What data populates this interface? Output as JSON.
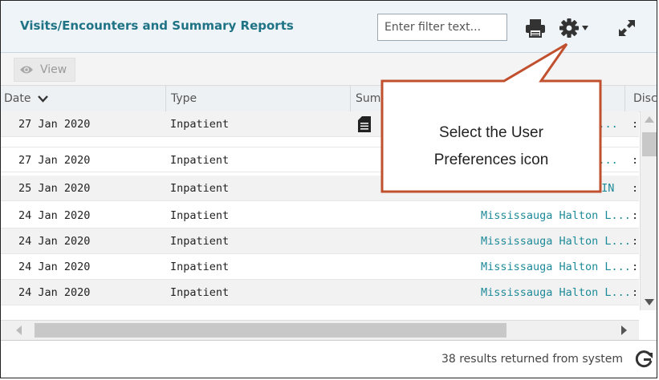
{
  "panel": {
    "title": "Visits/Encounters and Summary Reports",
    "filter_placeholder": "Enter filter text...",
    "print_icon": "printer-icon",
    "settings_icon": "gear-icon",
    "expand_icon": "expand-icon"
  },
  "toolbar": {
    "view_label": "View",
    "view_icon": "eye-icon"
  },
  "columns": {
    "date": "Date",
    "type": "Type",
    "summary": "Sum",
    "disc": "Disc"
  },
  "rows": [
    {
      "date": "27 Jan 2020",
      "type": "Inpatient",
      "has_doc": true,
      "source": "n L...",
      "extra": ":"
    },
    {
      "date": "27 Jan 2020",
      "type": "Inpatient",
      "has_doc": false,
      "source": "n L...",
      "extra": ":"
    },
    {
      "date": "25 Jan 2020",
      "type": "Inpatient",
      "has_doc": false,
      "source": "HIN",
      "extra": ":"
    },
    {
      "date": "24 Jan 2020",
      "type": "Inpatient",
      "has_doc": false,
      "source": "Mississauga Halton L...",
      "extra": ":"
    },
    {
      "date": "24 Jan 2020",
      "type": "Inpatient",
      "has_doc": false,
      "source": "Mississauga Halton L...",
      "extra": ":"
    },
    {
      "date": "24 Jan 2020",
      "type": "Inpatient",
      "has_doc": false,
      "source": "Mississauga Halton L...",
      "extra": ":"
    },
    {
      "date": "24 Jan 2020",
      "type": "Inpatient",
      "has_doc": false,
      "source": "Mississauga Halton L...",
      "extra": ":"
    }
  ],
  "footer": {
    "results": "38 results returned from system",
    "refresh_icon": "refresh-icon"
  },
  "callout": {
    "line1": "Select the User",
    "line2": "Preferences icon"
  },
  "colors": {
    "title": "#1f7385",
    "link": "#1e8a99",
    "callout_border": "#c0502e"
  }
}
